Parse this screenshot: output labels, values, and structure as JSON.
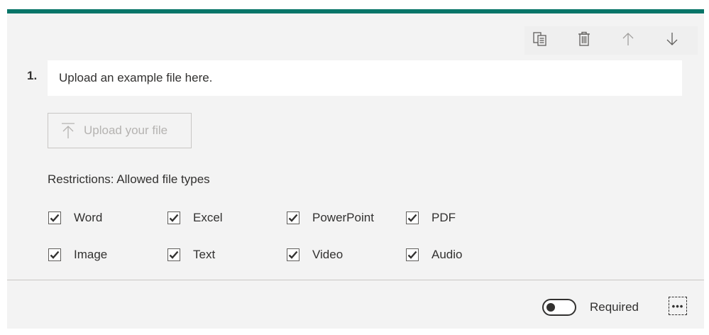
{
  "question": {
    "number": "1.",
    "title": "Upload an example file here."
  },
  "upload_button": {
    "label": "Upload your file",
    "icon": "upload-icon",
    "enabled": false
  },
  "toolbar": {
    "items": [
      {
        "icon": "copy-icon"
      },
      {
        "icon": "delete-icon"
      },
      {
        "icon": "arrow-up-icon"
      },
      {
        "icon": "arrow-down-icon"
      }
    ]
  },
  "restrictions": {
    "label": "Restrictions: Allowed file types",
    "options": [
      {
        "label": "Word",
        "checked": true
      },
      {
        "label": "Excel",
        "checked": true
      },
      {
        "label": "PowerPoint",
        "checked": true
      },
      {
        "label": "PDF",
        "checked": true
      },
      {
        "label": "Image",
        "checked": true
      },
      {
        "label": "Text",
        "checked": true
      },
      {
        "label": "Video",
        "checked": true
      },
      {
        "label": "Audio",
        "checked": true
      }
    ]
  },
  "footer": {
    "required_label": "Required",
    "required_on": false,
    "more_icon": "more-options-icon"
  },
  "colors": {
    "accent": "#077568",
    "card_background": "#f3f3f3",
    "text": "#323130",
    "disabled_text": "#b5b3b1"
  }
}
